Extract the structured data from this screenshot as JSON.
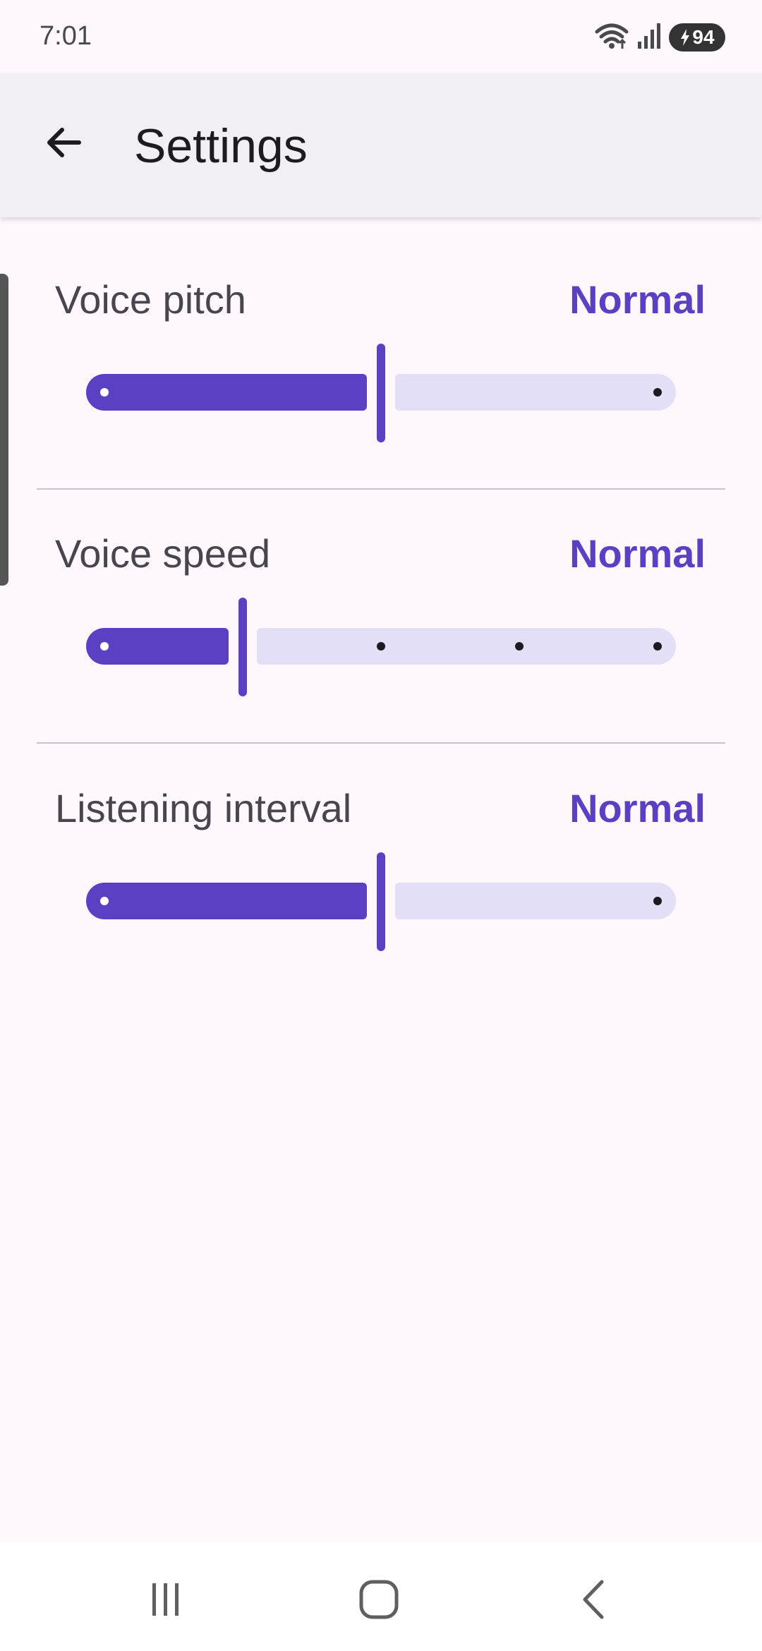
{
  "status_bar": {
    "time": "7:01",
    "battery": "94",
    "icons": [
      "wifi-icon",
      "signal-icon",
      "battery-icon",
      "charging-bolt-icon"
    ]
  },
  "app_bar": {
    "title": "Settings",
    "back_icon": "arrow-left-icon"
  },
  "settings": [
    {
      "label": "Voice pitch",
      "value": "Normal",
      "steps": 3,
      "level": 0.5
    },
    {
      "label": "Voice speed",
      "value": "Normal",
      "steps": 5,
      "level": 0.25
    },
    {
      "label": "Listening interval",
      "value": "Normal",
      "steps": 3,
      "level": 0.5
    }
  ],
  "nav_bar": {
    "icons": [
      "recent-apps-icon",
      "home-icon",
      "back-icon"
    ]
  },
  "colors": {
    "accent": "#5b40c4",
    "track_inactive": "#e2dff7",
    "background": "#fef7fc",
    "app_bar": "#f2eff4"
  }
}
